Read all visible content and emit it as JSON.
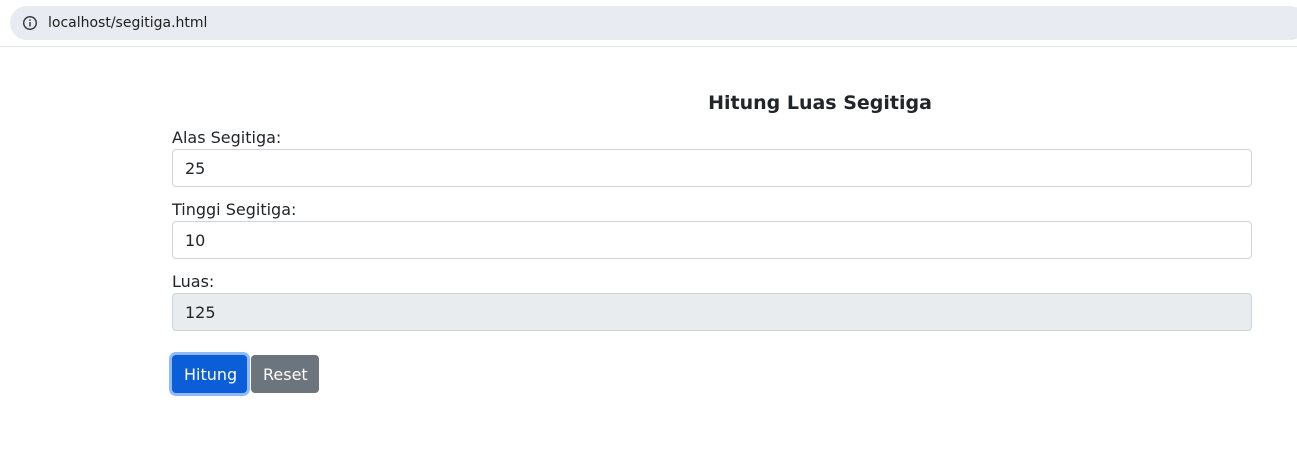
{
  "browser": {
    "url": "localhost/segitiga.html",
    "icons": {
      "site_info": "info-circle-icon"
    }
  },
  "form": {
    "title": "Hitung Luas Segitiga",
    "alas_label": "Alas Segitiga:",
    "alas_value": "25",
    "tinggi_label": "Tinggi Segitiga:",
    "tinggi_value": "10",
    "luas_label": "Luas:",
    "luas_value": "125",
    "hitung_label": "Hitung",
    "reset_label": "Reset"
  },
  "colors": {
    "primary": "#0b5ed7",
    "secondary": "#6c757d",
    "readonly_bg": "#e9ecef",
    "address_bar": "#e8ebf2"
  }
}
